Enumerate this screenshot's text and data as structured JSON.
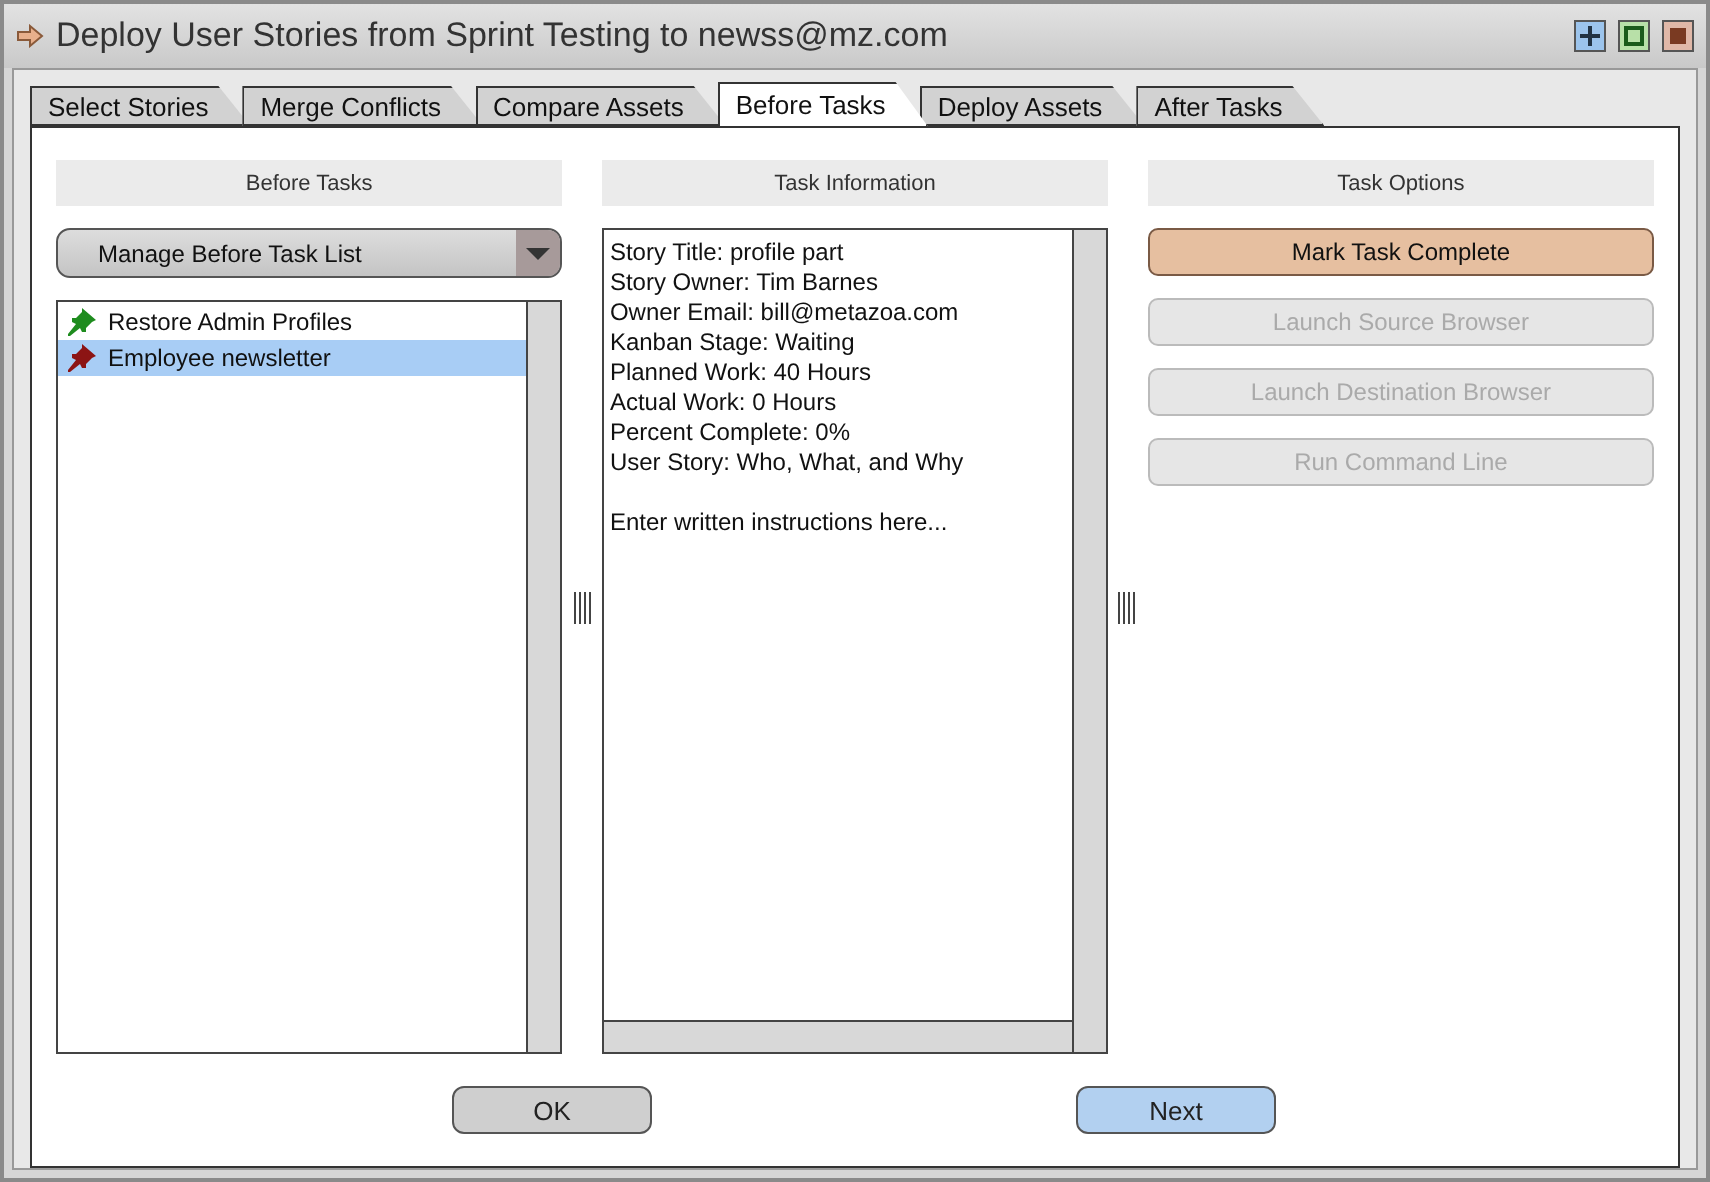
{
  "window": {
    "title": "Deploy User Stories from Sprint Testing to newss@mz.com"
  },
  "tabs": [
    {
      "label": "Select Stories",
      "selected": false
    },
    {
      "label": "Merge Conflicts",
      "selected": false
    },
    {
      "label": "Compare Assets",
      "selected": false
    },
    {
      "label": "Before Tasks",
      "selected": true
    },
    {
      "label": "Deploy Assets",
      "selected": false
    },
    {
      "label": "After Tasks",
      "selected": false
    }
  ],
  "before_tasks": {
    "header": "Before Tasks",
    "dropdown": "Manage Before Task List",
    "items": [
      {
        "label": "Restore Admin Profiles",
        "color": "#1e8c1e",
        "selected": false
      },
      {
        "label": "Employee newsletter",
        "color": "#8c1414",
        "selected": true
      }
    ]
  },
  "task_information": {
    "header": "Task Information",
    "lines": [
      "Story Title: profile part",
      "Story Owner: Tim Barnes",
      "Owner Email: bill@metazoa.com",
      "Kanban Stage: Waiting",
      "Planned Work: 40 Hours",
      "Actual Work: 0 Hours",
      "Percent Complete: 0%",
      "User Story: Who, What, and Why"
    ],
    "instructions": "Enter written instructions here..."
  },
  "task_options": {
    "header": "Task Options",
    "buttons": [
      {
        "label": "Mark Task Complete",
        "disabled": false
      },
      {
        "label": "Launch Source Browser",
        "disabled": true
      },
      {
        "label": "Launch Destination Browser",
        "disabled": true
      },
      {
        "label": "Run Command Line",
        "disabled": true
      }
    ]
  },
  "footer_buttons": [
    {
      "label": "OK",
      "kind": "default"
    },
    {
      "label": "Next",
      "kind": "primary"
    }
  ]
}
